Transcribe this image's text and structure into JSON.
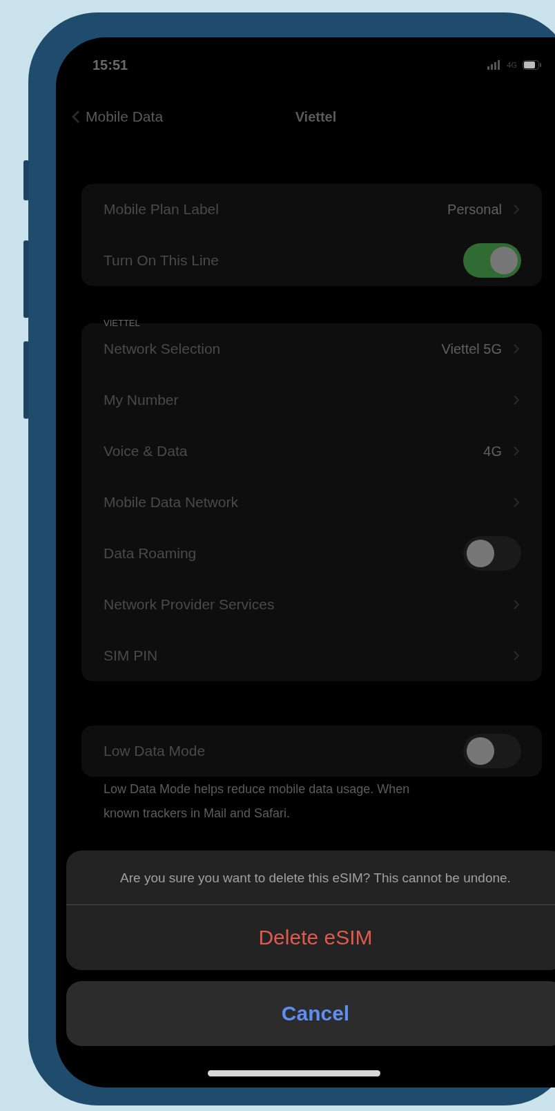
{
  "status_bar": {
    "time": "15:51",
    "network": "4G"
  },
  "nav": {
    "back": "Mobile Data",
    "title": "Viettel"
  },
  "groups": [
    {
      "rows": [
        {
          "kind": "link",
          "label": "Mobile Plan Label",
          "value": "Personal"
        },
        {
          "kind": "toggle",
          "label": "Turn On This Line",
          "on": true
        }
      ]
    },
    {
      "header": "VIETTEL",
      "rows": [
        {
          "kind": "link",
          "label": "Network Selection",
          "value": "Viettel 5G"
        },
        {
          "kind": "link",
          "label": "My Number"
        },
        {
          "kind": "link",
          "label": "Voice & Data",
          "value": "4G"
        },
        {
          "kind": "link",
          "label": "Mobile Data Network"
        },
        {
          "kind": "toggle",
          "label": "Data Roaming",
          "on": false
        },
        {
          "kind": "link",
          "label": "Network Provider Services"
        },
        {
          "kind": "link",
          "label": "SIM PIN"
        }
      ]
    },
    {
      "rows": [
        {
          "kind": "toggle",
          "label": "Low Data Mode",
          "on": false
        }
      ],
      "footer": [
        "Low Data Mode helps reduce mobile data usage. When",
        "known trackers in Mail and Safari."
      ]
    }
  ],
  "action_sheet": {
    "message": "Are you sure you want to delete this eSIM? This cannot be undone.",
    "destructive": "Delete eSIM",
    "cancel": "Cancel"
  }
}
